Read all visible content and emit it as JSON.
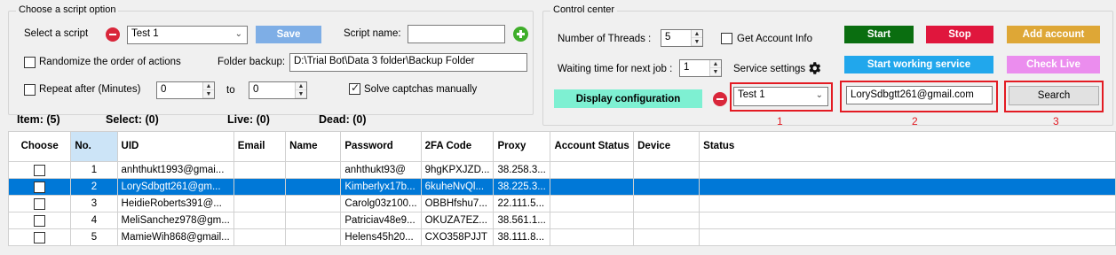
{
  "script_group": {
    "legend": "Choose a script option",
    "select_script_label": "Select a script",
    "script_selected": "Test 1",
    "save_label": "Save",
    "script_name_label": "Script name:",
    "script_name_value": "",
    "randomize_label": "Randomize the order of actions",
    "randomize_checked": false,
    "folder_backup_label": "Folder backup:",
    "folder_backup_value": "D:\\Trial Bot\\Data 3 folder\\Backup Folder",
    "repeat_label": "Repeat after (Minutes)",
    "repeat_checked": false,
    "repeat_from": "0",
    "to_label": "to",
    "repeat_to": "0",
    "solve_captcha_label": "Solve captchas manually",
    "solve_captcha_checked": true
  },
  "stats": {
    "item": "Item: (5)",
    "select": "Select: (0)",
    "live": "Live: (0)",
    "dead": "Dead: (0)"
  },
  "control_center": {
    "legend": "Control center",
    "threads_label": "Number of Threads :",
    "threads_value": "5",
    "get_account_info_label": "Get Account Info",
    "get_account_info_checked": false,
    "waiting_label": "Waiting time for next job :",
    "waiting_value": "1",
    "service_settings_label": "Service settings",
    "display_config_label": "Display configuration",
    "config_selected": "Test 1",
    "search_value": "LorySdbgtt261@gmail.com",
    "search_label": "Search",
    "buttons": {
      "start": "Start",
      "stop": "Stop",
      "add_account": "Add account",
      "start_service": "Start working service",
      "check_live": "Check Live"
    },
    "annotations": [
      "1",
      "2",
      "3"
    ]
  },
  "colors": {
    "save": "#7eaee6",
    "start": "#0a6e10",
    "stop": "#e0163d",
    "add_account": "#dea736",
    "start_service": "#21a7ec",
    "check_live": "#eb8dee",
    "display_config": "#7ef0d2",
    "selection": "#0078d7",
    "highlight": "#e31b23"
  },
  "table": {
    "columns": [
      "Choose",
      "No.",
      "UID",
      "Email",
      "Name",
      "Password",
      "2FA Code",
      "Proxy",
      "Account Status",
      "Device",
      "Status"
    ],
    "rows": [
      {
        "no": "1",
        "uid": "anhthukt1993@gmai...",
        "email": "",
        "name": "",
        "password": "anhthukt93@",
        "twofa": "9hgKPXJZD...",
        "proxy": "38.258.3...",
        "account_status": "",
        "device": "",
        "status": ""
      },
      {
        "no": "2",
        "uid": "LorySdbgtt261@gm...",
        "email": "",
        "name": "",
        "password": "Kimberlyx17b...",
        "twofa": "6kuheNvQl...",
        "proxy": "38.225.3...",
        "account_status": "",
        "device": "",
        "status": ""
      },
      {
        "no": "3",
        "uid": "HeidieRoberts391@...",
        "email": "",
        "name": "",
        "password": "Carolg03z100...",
        "twofa": "OBBHfshu7...",
        "proxy": "22.111.5...",
        "account_status": "",
        "device": "",
        "status": ""
      },
      {
        "no": "4",
        "uid": "MeliSanchez978@gm...",
        "email": "",
        "name": "",
        "password": "Patriciav48e9...",
        "twofa": "OKUZA7EZ...",
        "proxy": "38.561.1...",
        "account_status": "",
        "device": "",
        "status": ""
      },
      {
        "no": "5",
        "uid": "MamieWih868@gmail...",
        "email": "",
        "name": "",
        "password": "Helens45h20...",
        "twofa": "CXO358PJJT",
        "proxy": "38.111.8...",
        "account_status": "",
        "device": "",
        "status": ""
      }
    ]
  }
}
